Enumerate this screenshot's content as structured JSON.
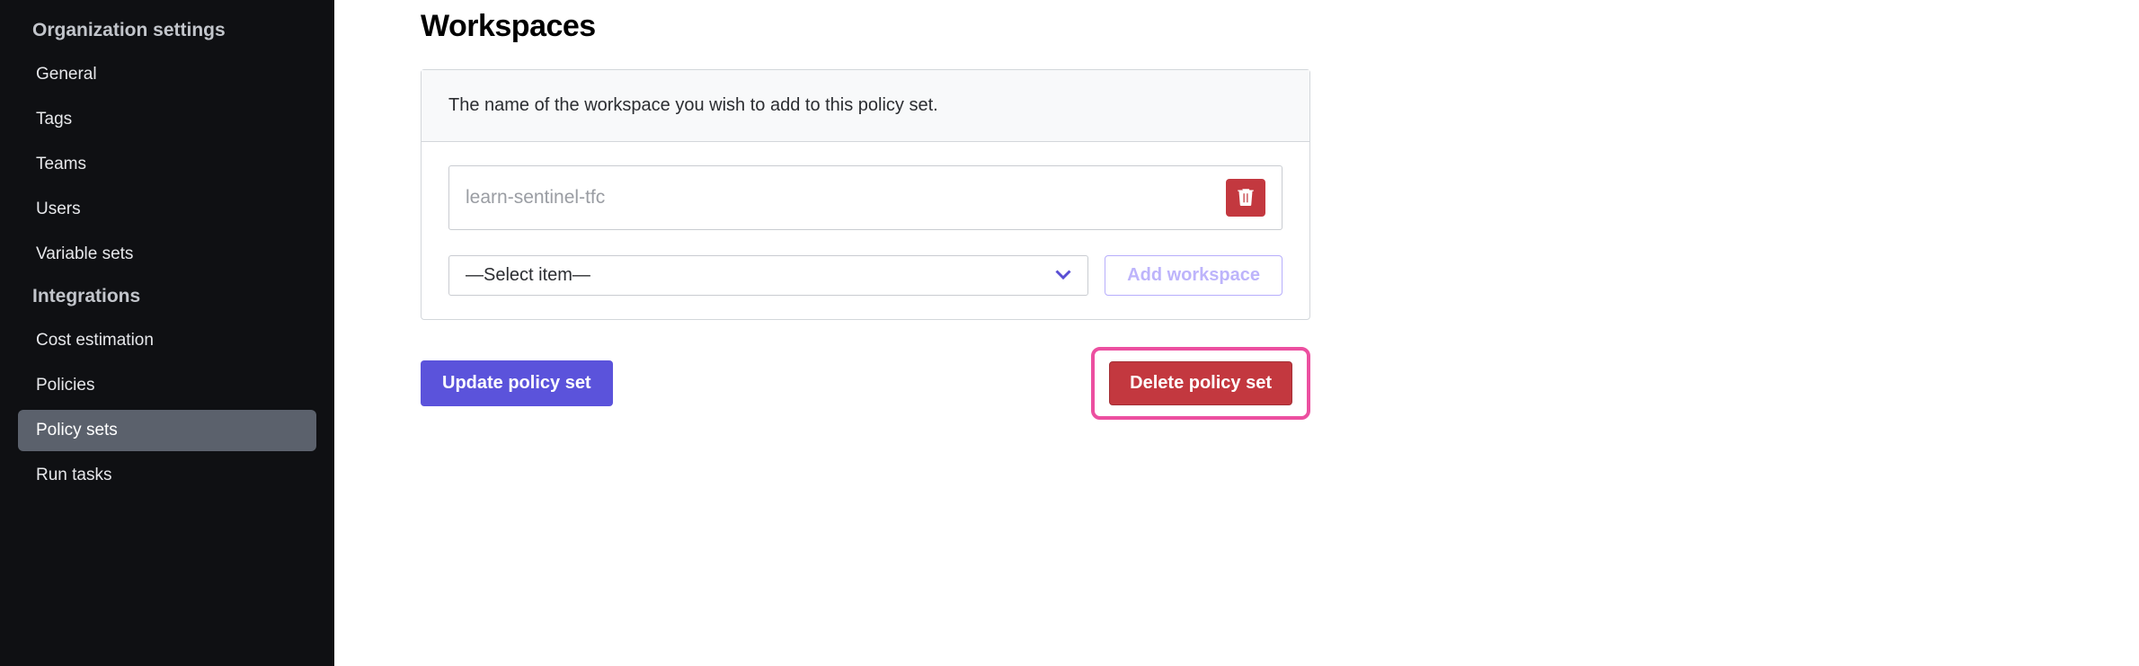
{
  "sidebar": {
    "heading_org": "Organization settings",
    "heading_int": "Integrations",
    "items_org": [
      {
        "label": "General"
      },
      {
        "label": "Tags"
      },
      {
        "label": "Teams"
      },
      {
        "label": "Users"
      },
      {
        "label": "Variable sets"
      }
    ],
    "items_int": [
      {
        "label": "Cost estimation"
      },
      {
        "label": "Policies"
      },
      {
        "label": "Policy sets"
      },
      {
        "label": "Run tasks"
      }
    ]
  },
  "main": {
    "title": "Workspaces",
    "panel_description": "The name of the workspace you wish to add to this policy set.",
    "workspace_item": "learn-sentinel-tfc",
    "select_placeholder": "—Select item—",
    "add_workspace_label": "Add workspace",
    "update_label": "Update policy set",
    "delete_label": "Delete policy set"
  }
}
